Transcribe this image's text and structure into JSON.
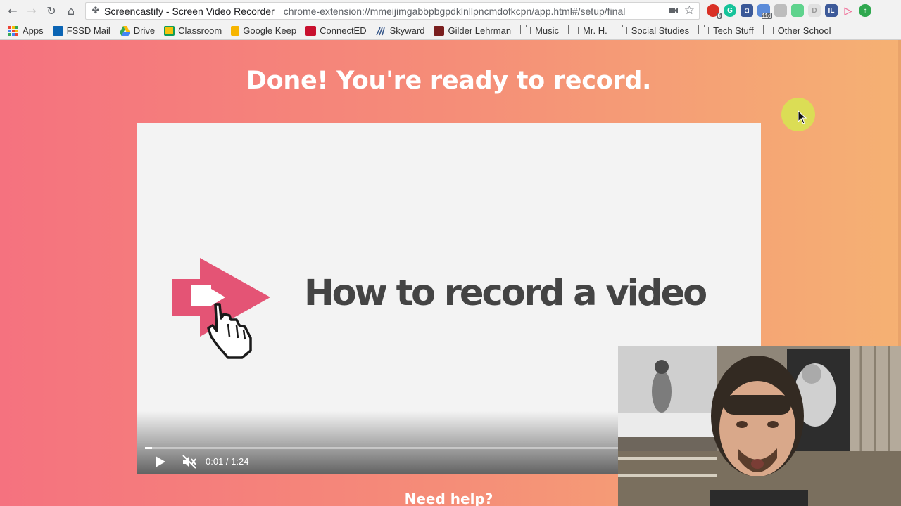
{
  "browser": {
    "tab_title": "Screencastify - Screen Video Recorder",
    "url": "chrome-extension://mmeijimgabbpbgpdklnllpncmdofkcpn/app.html#/setup/final",
    "extension_badges": [
      "6",
      "11d"
    ]
  },
  "bookmarks": [
    {
      "label": "Apps",
      "icon": "apps-grid-icon"
    },
    {
      "label": "FSSD Mail",
      "icon": "outlook-icon"
    },
    {
      "label": "Drive",
      "icon": "drive-icon"
    },
    {
      "label": "Classroom",
      "icon": "classroom-icon"
    },
    {
      "label": "Google Keep",
      "icon": "keep-icon"
    },
    {
      "label": "ConnectED",
      "icon": "connected-icon"
    },
    {
      "label": "Skyward",
      "icon": "skyward-icon"
    },
    {
      "label": "Gilder Lehrman",
      "icon": "gilder-icon"
    },
    {
      "label": "Music",
      "icon": "folder-icon"
    },
    {
      "label": "Mr. H.",
      "icon": "folder-icon"
    },
    {
      "label": "Social Studies",
      "icon": "folder-icon"
    },
    {
      "label": "Tech Stuff",
      "icon": "folder-icon"
    },
    {
      "label": "Other School",
      "icon": "folder-icon"
    }
  ],
  "page": {
    "headline": "Done! You're ready to record.",
    "footer_heading": "Need help?"
  },
  "video": {
    "caption": "How to record a video",
    "current_time": "0:01",
    "duration": "1:24",
    "time_display": "0:01 / 1:24",
    "progress_fraction": 0.012,
    "muted": true
  },
  "colors": {
    "gradient_left": "#f5727f",
    "gradient_right": "#f5b173",
    "brand_pink": "#e45475",
    "cursor_highlight": "#d6e650"
  }
}
